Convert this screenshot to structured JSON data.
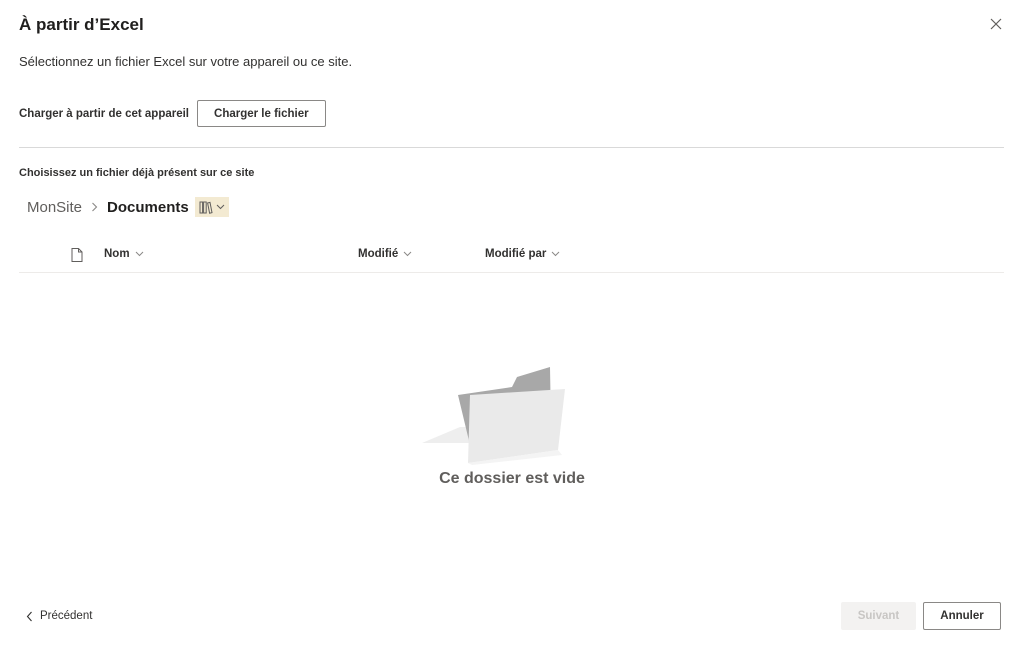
{
  "dialog": {
    "title": "À partir d’Excel",
    "subtitle": "Sélectionnez un fichier Excel sur votre appareil ou ce site.",
    "close_icon": "close-icon"
  },
  "upload": {
    "label": "Charger à partir de cet appareil",
    "button_label": "Charger le fichier"
  },
  "site_picker": {
    "label": "Choisissez un fichier déjà présent sur ce site",
    "breadcrumb": {
      "root": "MonSite",
      "current": "Documents",
      "separator_icon": "chevron-right-icon",
      "library_icon": "library-icon"
    },
    "columns": [
      {
        "label": "Nom"
      },
      {
        "label": "Modifié"
      },
      {
        "label": "Modifié par"
      }
    ],
    "empty_message": "Ce dossier est vide"
  },
  "footer": {
    "back_label": "Précédent",
    "next_label": "Suivant",
    "cancel_label": "Annuler"
  },
  "colors": {
    "accent_library_bg": "#f3ead2",
    "disabled_button_bg": "#f3f2f1",
    "disabled_button_text": "#c8c6c4",
    "divider": "#d9d9d9"
  }
}
